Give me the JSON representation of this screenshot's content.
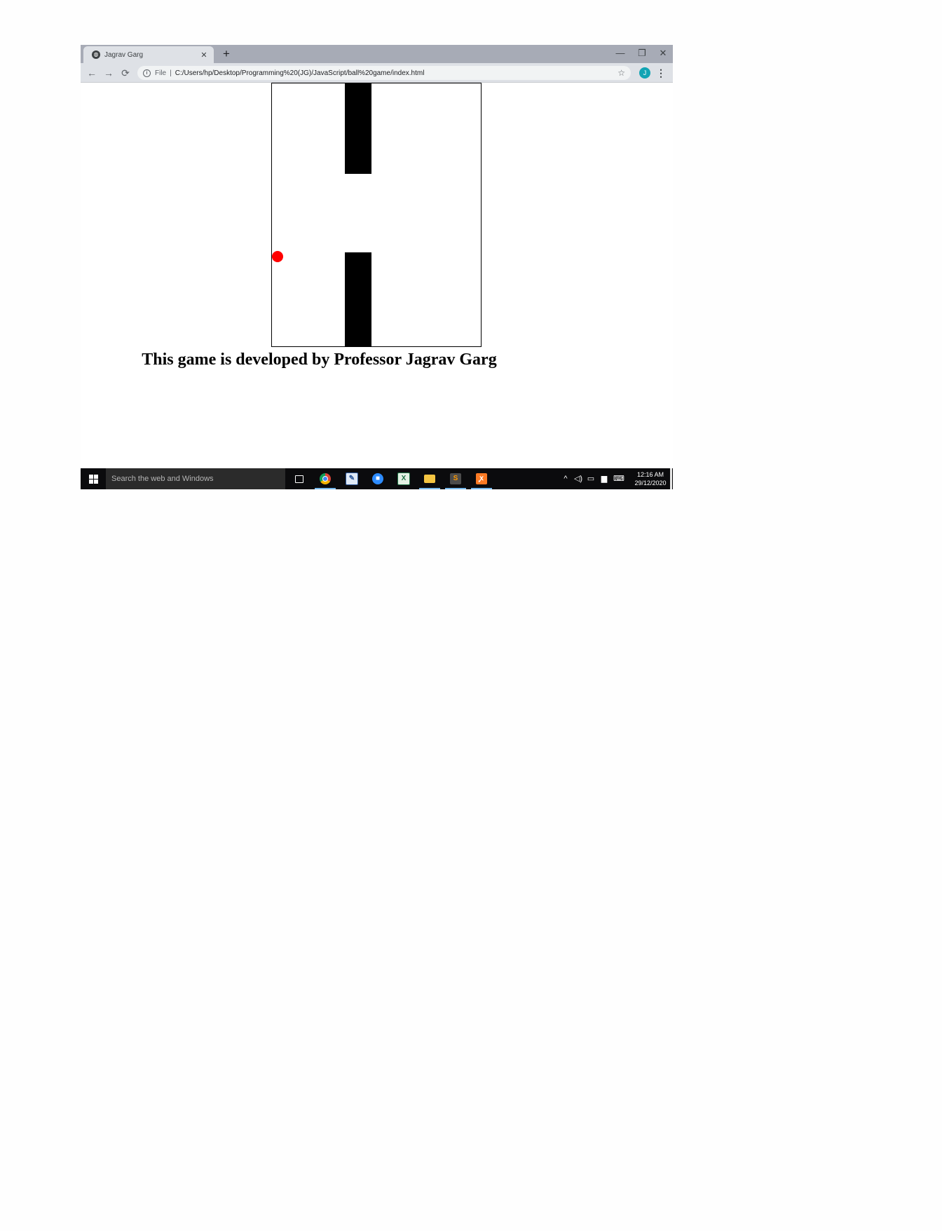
{
  "browser": {
    "tab_title": "Jagrav Garg",
    "tab_close": "✕",
    "new_tab": "+",
    "minimize": "—",
    "restore": "❐",
    "close": "✕",
    "scheme_label": "File",
    "separator": "|",
    "url": "C:/Users/hp/Desktop/Programming%20(JG)/JavaScript/ball%20game/index.html",
    "avatar_initial": "J",
    "icons": {
      "favicon": "globe-icon",
      "back": "arrow-left-icon",
      "forward": "arrow-right-icon",
      "reload": "reload-icon",
      "info": "info-icon",
      "bookmark": "star-icon",
      "menu": "kebab-menu-icon"
    },
    "colors": {
      "tab_strip": "#a7abb6",
      "toolbar": "#dee1e6",
      "avatar": "#12a4b4"
    }
  },
  "game": {
    "colors": {
      "pipe": "#000000",
      "ball": "#ff0000",
      "background": "#ffffff"
    },
    "credit_text": "This game is developed by Professor Jagrav Garg"
  },
  "taskbar": {
    "search_placeholder": "Search the web and Windows",
    "apps": [
      {
        "name": "task-view",
        "icon": "task-view-icon"
      },
      {
        "name": "chrome",
        "icon": "chrome-icon",
        "running": true
      },
      {
        "name": "notepad",
        "icon": "notepad-icon"
      },
      {
        "name": "zoom",
        "icon": "video-camera-icon"
      },
      {
        "name": "excel",
        "icon": "spreadsheet-icon"
      },
      {
        "name": "file-explorer",
        "icon": "folder-icon",
        "running": true
      },
      {
        "name": "sublime-text",
        "icon": "sublime-icon",
        "running": true
      },
      {
        "name": "xampp",
        "icon": "xampp-icon",
        "running": true
      }
    ],
    "tray": {
      "chevron": "^",
      "volume": "🔈",
      "network": "network-icon",
      "notifications": "notification-icon",
      "keyboard": "keyboard-icon"
    },
    "time": "12:16 AM",
    "date": "29/12/2020"
  }
}
